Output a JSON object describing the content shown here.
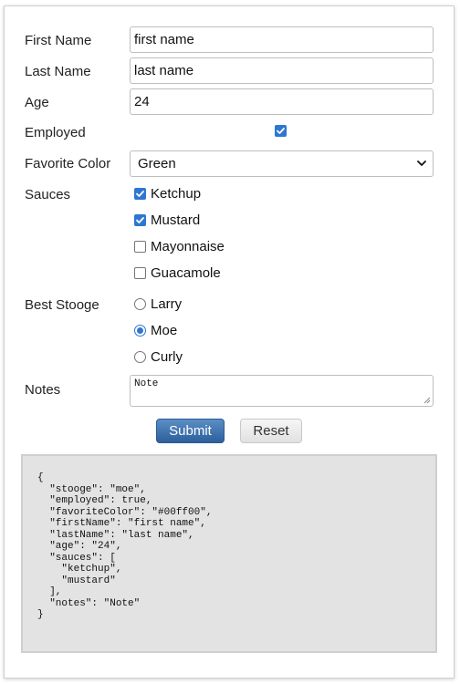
{
  "form": {
    "first_name": {
      "label": "First Name",
      "value": "first name"
    },
    "last_name": {
      "label": "Last Name",
      "value": "last name"
    },
    "age": {
      "label": "Age",
      "value": "24"
    },
    "employed": {
      "label": "Employed",
      "checked": true
    },
    "favorite_color": {
      "label": "Favorite Color",
      "selected": "Green"
    },
    "sauces": {
      "label": "Sauces",
      "options": [
        {
          "label": "Ketchup",
          "checked": true
        },
        {
          "label": "Mustard",
          "checked": true
        },
        {
          "label": "Mayonnaise",
          "checked": false
        },
        {
          "label": "Guacamole",
          "checked": false
        }
      ]
    },
    "best_stooge": {
      "label": "Best Stooge",
      "options": [
        {
          "label": "Larry",
          "selected": false
        },
        {
          "label": "Moe",
          "selected": true
        },
        {
          "label": "Curly",
          "selected": false
        }
      ]
    },
    "notes": {
      "label": "Notes",
      "value": "Note"
    }
  },
  "buttons": {
    "submit_label": "Submit",
    "reset_label": "Reset"
  },
  "json_output": "{\n  \"stooge\": \"moe\",\n  \"employed\": true,\n  \"favoriteColor\": \"#00ff00\",\n  \"firstName\": \"first name\",\n  \"lastName\": \"last name\",\n  \"age\": \"24\",\n  \"sauces\": [\n    \"ketchup\",\n    \"mustard\"\n  ],\n  \"notes\": \"Note\"\n}",
  "colors": {
    "accent": "#2f76d2",
    "submit_button": "#3a6ea8",
    "json_panel_bg": "#e3e3e3"
  }
}
